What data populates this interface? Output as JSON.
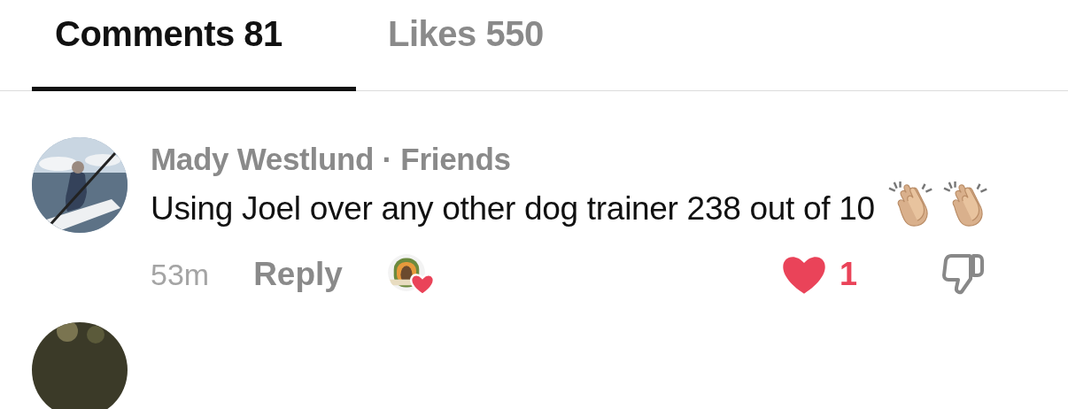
{
  "tabs": [
    {
      "label": "Comments 81",
      "selected": true
    },
    {
      "label": "Likes 550",
      "selected": false
    }
  ],
  "comments": [
    {
      "author_line": "Mady Westlund · Friends",
      "text": "Using Joel over any other dog trainer 238 out of 10",
      "time": "53m",
      "reply": "Reply",
      "liked_by_creator": true,
      "liked": true,
      "likes": "1",
      "disliked": false
    }
  ]
}
